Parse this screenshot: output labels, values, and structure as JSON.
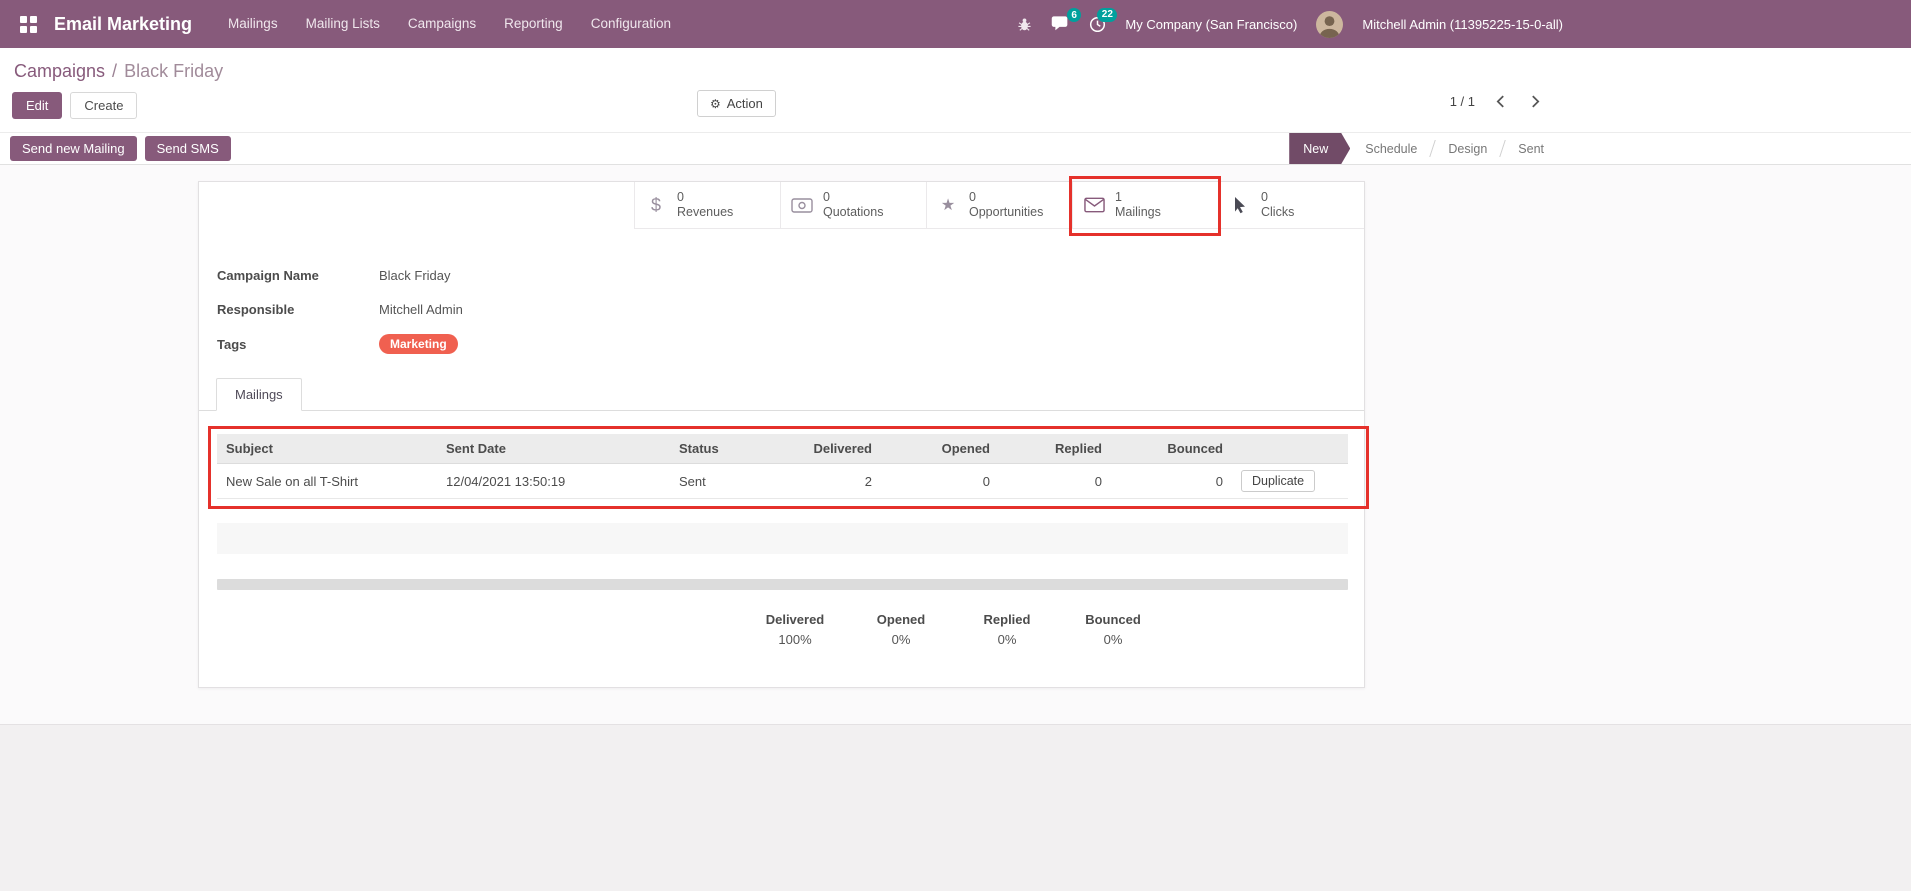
{
  "colors": {
    "primary": "#875A7B",
    "stage_active": "#714B67",
    "badge_teal": "#00A09D",
    "tag_orange": "#F06050",
    "link": "#7C7BAD",
    "annotation_red": "#E5312B"
  },
  "icons": {
    "apps": "grid",
    "debug": "bug",
    "messages": "chat-bubble",
    "activities": "clock",
    "action_gear": "⚙",
    "revenues_glyph": "$",
    "quotations": "money-card",
    "opportunities_glyph": "★",
    "mailings": "envelope",
    "clicks": "mouse-pointer"
  },
  "navbar": {
    "app_name": "Email Marketing",
    "menus": [
      "Mailings",
      "Mailing Lists",
      "Campaigns",
      "Reporting",
      "Configuration"
    ],
    "messages_badge": "6",
    "activities_badge": "22",
    "company": "My Company (San Francisco)",
    "user": "Mitchell Admin (11395225-15-0-all)"
  },
  "breadcrumb": {
    "parent": "Campaigns",
    "separator": "/",
    "current": "Black Friday"
  },
  "control_panel": {
    "edit": "Edit",
    "create": "Create",
    "action": "Action",
    "pager": "1 / 1"
  },
  "statusbar": {
    "send_new_mailing": "Send new Mailing",
    "send_sms": "Send SMS",
    "stages": [
      {
        "label": "New",
        "active": true
      },
      {
        "label": "Schedule",
        "active": false
      },
      {
        "label": "Design",
        "active": false
      },
      {
        "label": "Sent",
        "active": false
      }
    ]
  },
  "stats": [
    {
      "value": "0",
      "label": "Revenues"
    },
    {
      "value": "0",
      "label": "Quotations"
    },
    {
      "value": "0",
      "label": "Opportunities"
    },
    {
      "value": "1",
      "label": "Mailings"
    },
    {
      "value": "0",
      "label": "Clicks"
    }
  ],
  "form": {
    "campaign_name_label": "Campaign Name",
    "campaign_name": "Black Friday",
    "responsible_label": "Responsible",
    "responsible": "Mitchell Admin",
    "tags_label": "Tags",
    "tag": "Marketing"
  },
  "notebook": {
    "tab": "Mailings"
  },
  "table": {
    "headers": [
      "Subject",
      "Sent Date",
      "Status",
      "Delivered",
      "Opened",
      "Replied",
      "Bounced",
      ""
    ],
    "rows": [
      {
        "subject": "New Sale on all T-Shirt",
        "sent_date": "12/04/2021 13:50:19",
        "status": "Sent",
        "delivered": "2",
        "opened": "0",
        "replied": "0",
        "bounced": "0",
        "action": "Duplicate"
      }
    ]
  },
  "kpis": [
    {
      "label": "Delivered",
      "value": "100%"
    },
    {
      "label": "Opened",
      "value": "0%"
    },
    {
      "label": "Replied",
      "value": "0%"
    },
    {
      "label": "Bounced",
      "value": "0%"
    }
  ]
}
